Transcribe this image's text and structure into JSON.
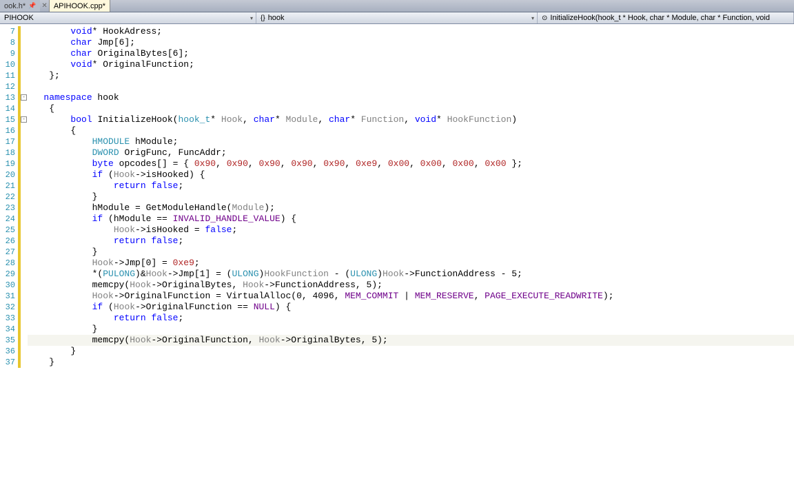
{
  "tabs": [
    {
      "label": "ook.h*",
      "active": false
    },
    {
      "label": "APIHOOK.cpp*",
      "active": true
    }
  ],
  "nav": {
    "scope": "PIHOOK",
    "namespace_icon": "{}",
    "namespace": "hook",
    "function_icon": "⊙",
    "function": "InitializeHook(hook_t * Hook, char * Module, char * Function, void"
  },
  "first_line_no": 7,
  "last_line_no": 37,
  "fold_boxes": [
    {
      "line": 13,
      "glyph": "-"
    },
    {
      "line": 15,
      "glyph": "-"
    }
  ],
  "current_line": 35,
  "code_lines": [
    {
      "n": 7,
      "tokens": [
        [
          "",
          "        "
        ],
        [
          "kw",
          "void"
        ],
        [
          "",
          "* HookAdress;"
        ]
      ]
    },
    {
      "n": 8,
      "tokens": [
        [
          "",
          "        "
        ],
        [
          "kw",
          "char"
        ],
        [
          "",
          " Jmp[6];"
        ]
      ]
    },
    {
      "n": 9,
      "tokens": [
        [
          "",
          "        "
        ],
        [
          "kw",
          "char"
        ],
        [
          "",
          " OriginalBytes[6];"
        ]
      ]
    },
    {
      "n": 10,
      "tokens": [
        [
          "",
          "        "
        ],
        [
          "kw",
          "void"
        ],
        [
          "",
          "* OriginalFunction;"
        ]
      ]
    },
    {
      "n": 11,
      "tokens": [
        [
          "",
          "    };"
        ]
      ]
    },
    {
      "n": 12,
      "tokens": [
        [
          "",
          ""
        ]
      ]
    },
    {
      "n": 13,
      "tokens": [
        [
          "",
          "   "
        ],
        [
          "kw",
          "namespace"
        ],
        [
          "",
          " hook"
        ]
      ]
    },
    {
      "n": 14,
      "tokens": [
        [
          "",
          "    {"
        ]
      ]
    },
    {
      "n": 15,
      "tokens": [
        [
          "",
          "        "
        ],
        [
          "kw",
          "bool"
        ],
        [
          "",
          " InitializeHook("
        ],
        [
          "type",
          "hook_t"
        ],
        [
          "",
          "* "
        ],
        [
          "param",
          "Hook"
        ],
        [
          "",
          ", "
        ],
        [
          "kw",
          "char"
        ],
        [
          "",
          "* "
        ],
        [
          "param",
          "Module"
        ],
        [
          "",
          ", "
        ],
        [
          "kw",
          "char"
        ],
        [
          "",
          "* "
        ],
        [
          "param",
          "Function"
        ],
        [
          "",
          ", "
        ],
        [
          "kw",
          "void"
        ],
        [
          "",
          "* "
        ],
        [
          "param",
          "HookFunction"
        ],
        [
          "",
          ")"
        ]
      ]
    },
    {
      "n": 16,
      "tokens": [
        [
          "",
          "        {"
        ]
      ]
    },
    {
      "n": 17,
      "tokens": [
        [
          "",
          "            "
        ],
        [
          "type",
          "HMODULE"
        ],
        [
          "",
          " hModule;"
        ]
      ]
    },
    {
      "n": 18,
      "tokens": [
        [
          "",
          "            "
        ],
        [
          "type",
          "DWORD"
        ],
        [
          "",
          " OrigFunc, FuncAddr;"
        ]
      ]
    },
    {
      "n": 19,
      "tokens": [
        [
          "",
          "            "
        ],
        [
          "kw",
          "byte"
        ],
        [
          "",
          " opcodes[] = { "
        ],
        [
          "num",
          "0x90"
        ],
        [
          "",
          ", "
        ],
        [
          "num",
          "0x90"
        ],
        [
          "",
          ", "
        ],
        [
          "num",
          "0x90"
        ],
        [
          "",
          ", "
        ],
        [
          "num",
          "0x90"
        ],
        [
          "",
          ", "
        ],
        [
          "num",
          "0x90"
        ],
        [
          "",
          ", "
        ],
        [
          "num",
          "0xe9"
        ],
        [
          "",
          ", "
        ],
        [
          "num",
          "0x00"
        ],
        [
          "",
          ", "
        ],
        [
          "num",
          "0x00"
        ],
        [
          "",
          ", "
        ],
        [
          "num",
          "0x00"
        ],
        [
          "",
          ", "
        ],
        [
          "num",
          "0x00"
        ],
        [
          "",
          " };"
        ]
      ]
    },
    {
      "n": 20,
      "tokens": [
        [
          "",
          "            "
        ],
        [
          "kw",
          "if"
        ],
        [
          "",
          " ("
        ],
        [
          "param",
          "Hook"
        ],
        [
          "",
          "->isHooked) {"
        ]
      ]
    },
    {
      "n": 21,
      "tokens": [
        [
          "",
          "                "
        ],
        [
          "kw",
          "return"
        ],
        [
          "",
          " "
        ],
        [
          "kw",
          "false"
        ],
        [
          "",
          ";"
        ]
      ]
    },
    {
      "n": 22,
      "tokens": [
        [
          "",
          "            }"
        ]
      ]
    },
    {
      "n": 23,
      "tokens": [
        [
          "",
          "            hModule = "
        ],
        [
          "",
          "GetModuleHandle"
        ],
        [
          "",
          "("
        ],
        [
          "param",
          "Module"
        ],
        [
          "",
          ");"
        ]
      ]
    },
    {
      "n": 24,
      "tokens": [
        [
          "",
          "            "
        ],
        [
          "kw",
          "if"
        ],
        [
          "",
          " (hModule == "
        ],
        [
          "macro",
          "INVALID_HANDLE_VALUE"
        ],
        [
          "",
          ") {"
        ]
      ]
    },
    {
      "n": 25,
      "tokens": [
        [
          "",
          "                "
        ],
        [
          "param",
          "Hook"
        ],
        [
          "",
          "->isHooked = "
        ],
        [
          "kw",
          "false"
        ],
        [
          "",
          ";"
        ]
      ]
    },
    {
      "n": 26,
      "tokens": [
        [
          "",
          "                "
        ],
        [
          "kw",
          "return"
        ],
        [
          "",
          " "
        ],
        [
          "kw",
          "false"
        ],
        [
          "",
          ";"
        ]
      ]
    },
    {
      "n": 27,
      "tokens": [
        [
          "",
          "            }"
        ]
      ]
    },
    {
      "n": 28,
      "tokens": [
        [
          "",
          "            "
        ],
        [
          "param",
          "Hook"
        ],
        [
          "",
          "->Jmp[0] = "
        ],
        [
          "num",
          "0xe9"
        ],
        [
          "",
          ";"
        ]
      ]
    },
    {
      "n": 29,
      "tokens": [
        [
          "",
          "            *("
        ],
        [
          "type",
          "PULONG"
        ],
        [
          "",
          ")&"
        ],
        [
          "param",
          "Hook"
        ],
        [
          "",
          "->Jmp[1] = ("
        ],
        [
          "type",
          "ULONG"
        ],
        [
          "",
          ")"
        ],
        [
          "param",
          "HookFunction"
        ],
        [
          "",
          " - ("
        ],
        [
          "type",
          "ULONG"
        ],
        [
          "",
          ")"
        ],
        [
          "param",
          "Hook"
        ],
        [
          "",
          "->FunctionAddress - 5;"
        ]
      ]
    },
    {
      "n": 30,
      "tokens": [
        [
          "",
          "            memcpy("
        ],
        [
          "param",
          "Hook"
        ],
        [
          "",
          "->OriginalBytes, "
        ],
        [
          "param",
          "Hook"
        ],
        [
          "",
          "->FunctionAddress, 5);"
        ]
      ]
    },
    {
      "n": 31,
      "tokens": [
        [
          "",
          "            "
        ],
        [
          "param",
          "Hook"
        ],
        [
          "",
          "->OriginalFunction = VirtualAlloc(0, 4096, "
        ],
        [
          "macro",
          "MEM_COMMIT"
        ],
        [
          "",
          " | "
        ],
        [
          "macro",
          "MEM_RESERVE"
        ],
        [
          "",
          ", "
        ],
        [
          "macro",
          "PAGE_EXECUTE_READWRITE"
        ],
        [
          "",
          ");"
        ]
      ]
    },
    {
      "n": 32,
      "tokens": [
        [
          "",
          "            "
        ],
        [
          "kw",
          "if"
        ],
        [
          "",
          " ("
        ],
        [
          "param",
          "Hook"
        ],
        [
          "",
          "->OriginalFunction == "
        ],
        [
          "macro",
          "NULL"
        ],
        [
          "",
          ") {"
        ]
      ]
    },
    {
      "n": 33,
      "tokens": [
        [
          "",
          "                "
        ],
        [
          "kw",
          "return"
        ],
        [
          "",
          " "
        ],
        [
          "kw",
          "false"
        ],
        [
          "",
          ";"
        ]
      ]
    },
    {
      "n": 34,
      "tokens": [
        [
          "",
          "            }"
        ]
      ]
    },
    {
      "n": 35,
      "tokens": [
        [
          "",
          "            memcpy("
        ],
        [
          "param",
          "Hook"
        ],
        [
          "",
          "->OriginalFunction, "
        ],
        [
          "param",
          "Hook"
        ],
        [
          "",
          "->OriginalBytes, 5);"
        ]
      ]
    },
    {
      "n": 36,
      "tokens": [
        [
          "",
          "        }"
        ]
      ]
    },
    {
      "n": 37,
      "tokens": [
        [
          "",
          "    }"
        ]
      ]
    }
  ]
}
